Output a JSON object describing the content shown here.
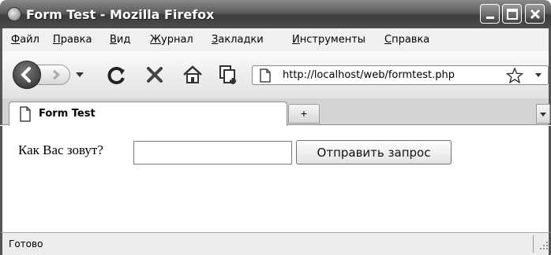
{
  "window": {
    "title": "Form Test - Mozilla Firefox"
  },
  "menu": {
    "items": [
      "Файл",
      "Правка",
      "Вид",
      "Журнал",
      "Закладки",
      "Инструменты",
      "Справка"
    ]
  },
  "navbar": {
    "url": "http://localhost/web/formtest.php"
  },
  "tabs": {
    "active_title": "Form Test",
    "new_tab_symbol": "+"
  },
  "form": {
    "label": "Как Вас зовут?",
    "input_value": "",
    "submit_label": "Отправить запрос"
  },
  "status": {
    "text": "Готово"
  },
  "icons": {
    "app": "firefox-icon",
    "back": "back-arrow-icon",
    "forward": "forward-arrow-icon",
    "reload": "reload-icon",
    "stop": "stop-icon",
    "home": "home-icon",
    "bookmark_star": "star-icon",
    "page": "page-icon"
  }
}
